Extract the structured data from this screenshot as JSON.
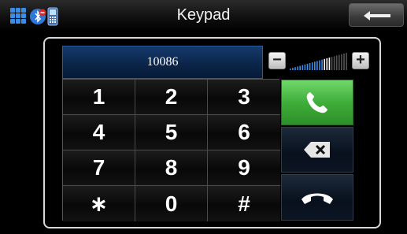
{
  "header": {
    "title": "Keypad",
    "icons": [
      "apps-grid-icon",
      "bluetooth-disabled-icon",
      "phone-icon"
    ],
    "back_icon": "back-arrow-icon"
  },
  "display": {
    "number": "10086"
  },
  "volume": {
    "minus_label": "−",
    "plus_label": "+",
    "level": 0.7
  },
  "keypad": {
    "keys": [
      "1",
      "2",
      "3",
      "4",
      "5",
      "6",
      "7",
      "8",
      "9",
      "∗",
      "0",
      "#"
    ]
  },
  "actions": {
    "call_icon": "phone-call-icon",
    "delete_icon": "backspace-icon",
    "hangup_icon": "hang-up-icon"
  },
  "colors": {
    "call_green": "#3fae3a",
    "display_blue": "#0b2447",
    "accent_blue": "#3a8ee8"
  }
}
